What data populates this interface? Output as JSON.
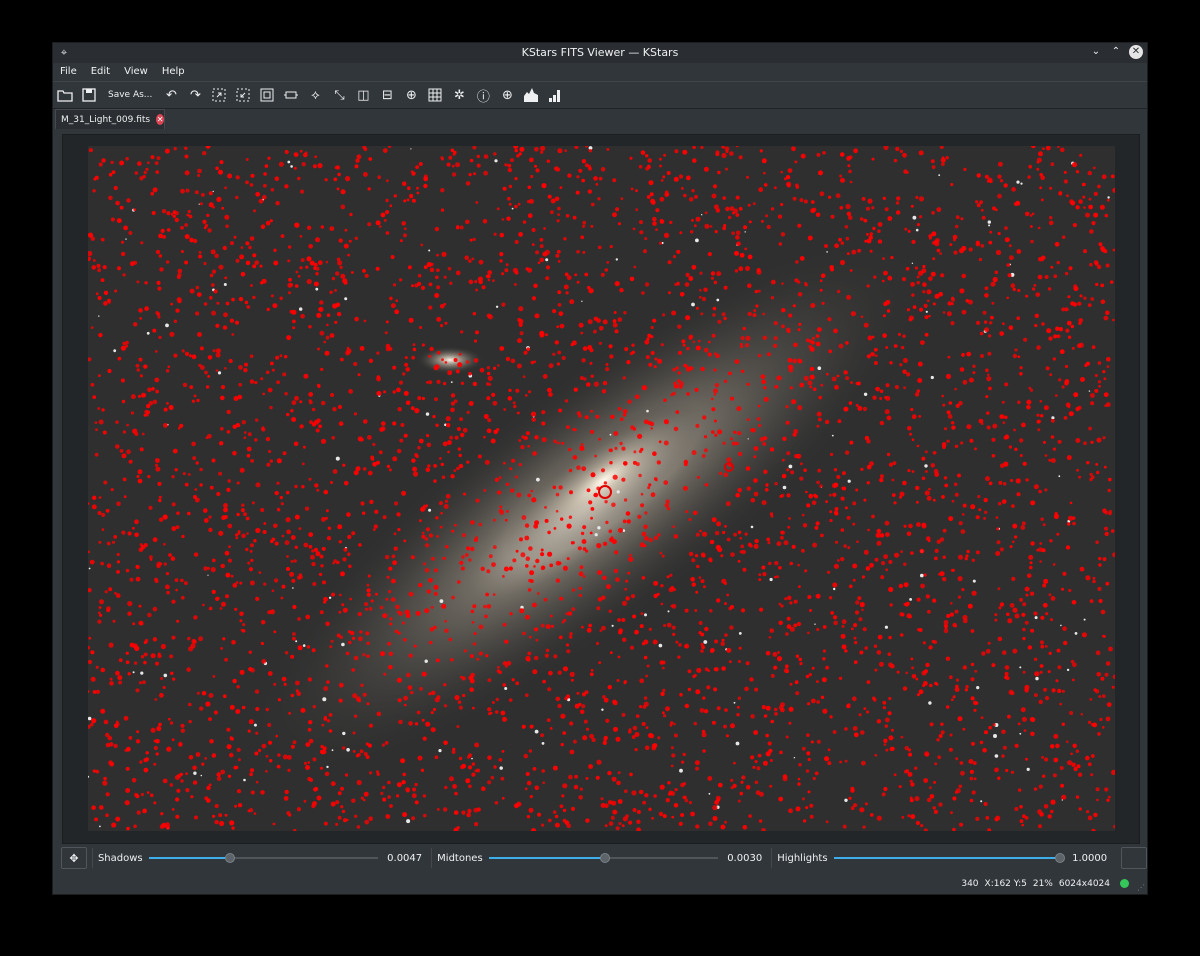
{
  "window": {
    "title": "KStars FITS Viewer — KStars"
  },
  "menu": [
    "File",
    "Edit",
    "View",
    "Help"
  ],
  "toolbar": {
    "save_as_label": "Save As..."
  },
  "tabs": [
    {
      "label": "M_31_Light_009.fits"
    }
  ],
  "stretch": {
    "shadows_label": "Shadows",
    "shadows_value": "0.0047",
    "shadows_fraction": 0.35,
    "midtones_label": "Midtones",
    "midtones_value": "0.0030",
    "midtones_fraction": 0.5,
    "highlights_label": "Highlights",
    "highlights_value": "1.0000",
    "highlights_fraction": 1.0
  },
  "status": {
    "star_count": "340",
    "cursor": "X:162 Y:5",
    "zoom": "21%",
    "resolution": "6024x4024",
    "indicator_color": "#34c759"
  },
  "colors": {
    "accent": "#3daee9",
    "star_marker": "#ff0000",
    "close": "#da4453"
  }
}
